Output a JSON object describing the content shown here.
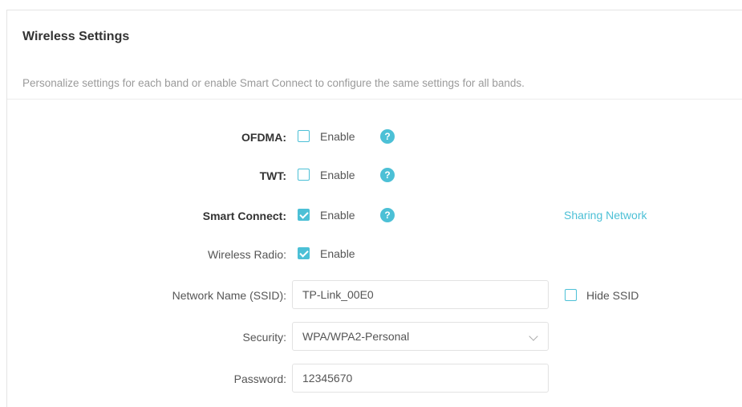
{
  "section": {
    "title": "Wireless Settings",
    "description": "Personalize settings for each band or enable Smart Connect to configure the same settings for all bands."
  },
  "rows": {
    "ofdma": {
      "label": "OFDMA:",
      "checkbox_label": "Enable",
      "checked": false,
      "help": "?"
    },
    "twt": {
      "label": "TWT:",
      "checkbox_label": "Enable",
      "checked": false,
      "help": "?"
    },
    "smart_connect": {
      "label": "Smart Connect:",
      "checkbox_label": "Enable",
      "checked": true,
      "help": "?",
      "link": "Sharing Network"
    },
    "wireless_radio": {
      "label": "Wireless Radio:",
      "checkbox_label": "Enable",
      "checked": true
    },
    "ssid": {
      "label": "Network Name (SSID):",
      "value": "TP-Link_00E0",
      "hide_label": "Hide SSID",
      "hide_checked": false
    },
    "security": {
      "label": "Security:",
      "value": "WPA/WPA2-Personal"
    },
    "password": {
      "label": "Password:",
      "value": "12345670"
    }
  },
  "colors": {
    "accent": "#4cc0d6",
    "text": "#333333",
    "muted": "#9a9a9a"
  }
}
